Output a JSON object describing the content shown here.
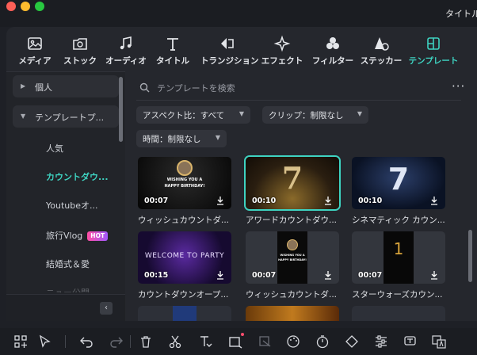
{
  "window": {
    "title": "タイトル"
  },
  "media_tabs": [
    {
      "label": "メディア",
      "icon": "image-icon"
    },
    {
      "label": "ストック",
      "icon": "stock-icon"
    },
    {
      "label": "オーディオ",
      "icon": "music-note-icon"
    },
    {
      "label": "タイトル",
      "icon": "text-t-icon"
    },
    {
      "label": "トランジション",
      "icon": "transition-icon"
    },
    {
      "label": "エフェクト",
      "icon": "sparkle-icon"
    },
    {
      "label": "フィルター",
      "icon": "filter-circles-icon"
    },
    {
      "label": "ステッカー",
      "icon": "sticker-icon"
    },
    {
      "label": "テンプレート",
      "icon": "template-grid-icon",
      "active": true
    }
  ],
  "sidebar": {
    "personal": "個人",
    "template_pack": "テンプレートプ...",
    "items": [
      {
        "label": "人気"
      },
      {
        "label": "カウントダウ...",
        "active": true
      },
      {
        "label": "Youtubeオ..."
      },
      {
        "label": "旅行Vlog",
        "badge": "HOT"
      },
      {
        "label": "結婚式＆愛"
      },
      {
        "label": "ニュー公開"
      }
    ]
  },
  "search": {
    "placeholder": "テンプレートを検索"
  },
  "filters": {
    "aspect": "アスペクト比：すべて",
    "clip": "クリップ：制限なし",
    "time": "時間：制限なし"
  },
  "templates": [
    {
      "title": "ウィッシュカウントダ...",
      "duration": "00:07",
      "thumb_text": [
        "WISHING YOU A",
        "HAPPY BIRTHDAY!"
      ]
    },
    {
      "title": "アワードカウントダウ...",
      "duration": "00:10",
      "thumb_text": [
        "7"
      ],
      "selected": true
    },
    {
      "title": "シネマティック カウン...",
      "duration": "00:10",
      "thumb_text": [
        "7"
      ]
    },
    {
      "title": "カウントダウンオープ...",
      "duration": "00:15",
      "thumb_text": [
        "WELCOME TO PARTY"
      ]
    },
    {
      "title": "ウィッシュカウントダ...",
      "duration": "00:07",
      "thumb_text": [
        "WISHING YOU A",
        "HAPPY BIRTHDAY!"
      ]
    },
    {
      "title": "スターウォーズカウン...",
      "duration": "00:07",
      "thumb_text": [
        "1"
      ]
    }
  ],
  "colors": {
    "accent": "#3ed3c1",
    "hot_badge": "#ff4fa3",
    "background": "#25272d"
  }
}
